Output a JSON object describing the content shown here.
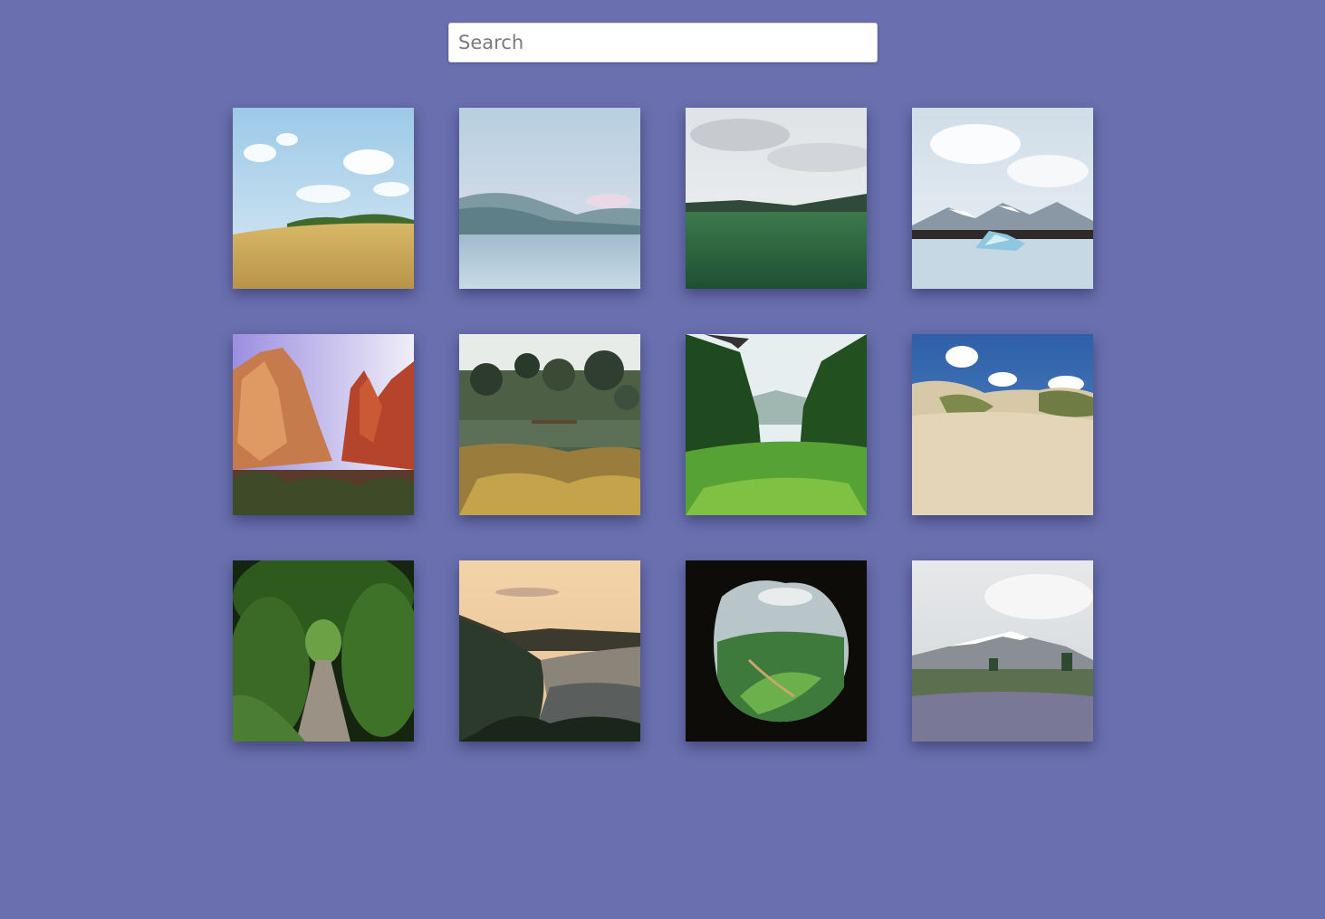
{
  "search": {
    "placeholder": "Search",
    "value": ""
  },
  "gallery": {
    "photos": [
      {
        "name": "wheat-field-photo"
      },
      {
        "name": "mountain-lake-photo"
      },
      {
        "name": "green-grassland-photo"
      },
      {
        "name": "glacier-lagoon-photo"
      },
      {
        "name": "red-canyon-cliffs-photo"
      },
      {
        "name": "garden-trees-photo"
      },
      {
        "name": "green-valley-photo"
      },
      {
        "name": "sand-dunes-photo"
      },
      {
        "name": "forest-path-photo"
      },
      {
        "name": "coastal-sunset-photo"
      },
      {
        "name": "cave-view-valley-photo"
      },
      {
        "name": "snowy-mountain-meadow-photo"
      }
    ]
  },
  "colors": {
    "background": "#6a6faf"
  }
}
